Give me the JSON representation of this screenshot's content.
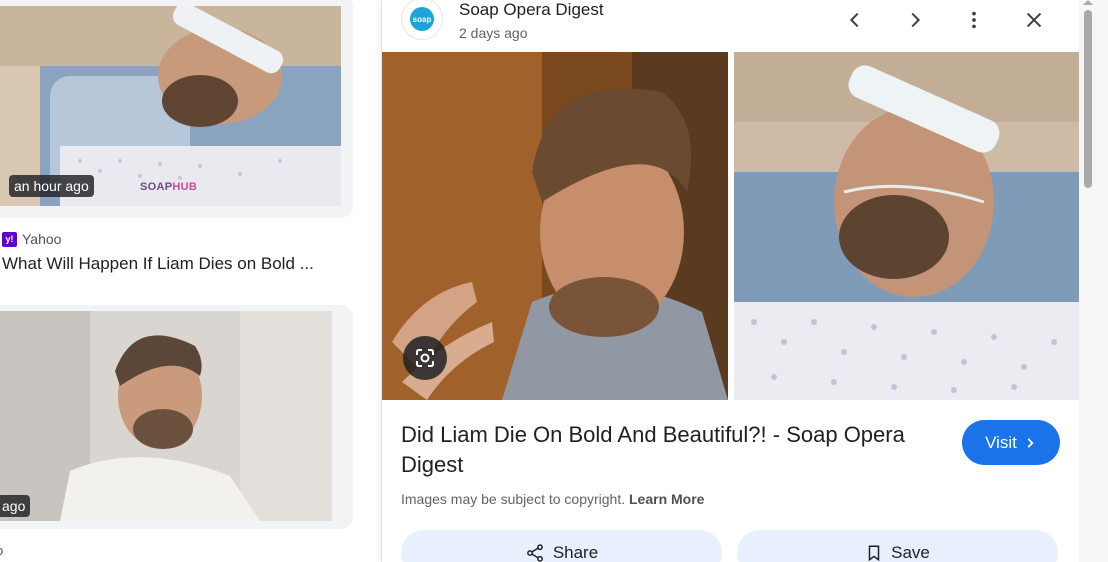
{
  "left_results": [
    {
      "time_badge": "an hour ago",
      "watermark_a": "SOAP",
      "watermark_b": "HUB",
      "source": "Yahoo",
      "source_icon": "yahoo-logo",
      "title": "What Will Happen If Liam Dies on Bold ..."
    },
    {
      "time_badge": "ago",
      "source": "o"
    }
  ],
  "panel": {
    "site_logo_text": "soap",
    "site_name": "Soap Opera Digest",
    "time": "2 days ago",
    "controls": [
      "chevron-left-icon",
      "chevron-right-icon",
      "more-vert-icon",
      "close-icon"
    ],
    "title": "Did Liam Die On Bold And Beautiful?! - Soap Opera Digest",
    "visit_label": "Visit",
    "copyright_text": "Images may be subject to copyright.",
    "learn_more": "Learn More",
    "share_label": "Share",
    "save_label": "Save"
  },
  "colors": {
    "accent": "#1a73e8",
    "action_bg": "#e8f0fe",
    "badge_bg": "#202124",
    "yahoo": "#6001d2"
  }
}
